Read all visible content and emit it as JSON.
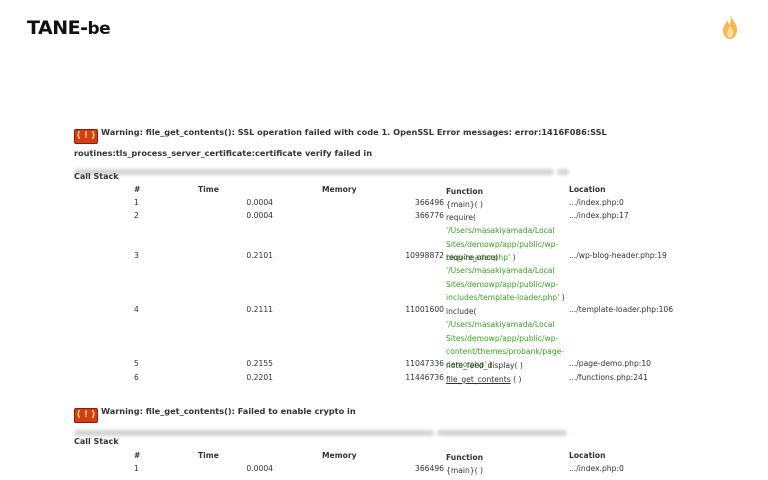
{
  "logo": {
    "main": "TANE",
    "sep": "-",
    "suffix": "be"
  },
  "warnings": [
    {
      "badge": "( ! )",
      "text": "Warning: file_get_contents(): SSL operation failed with code 1. OpenSSL Error messages: error:1416F086:SSL routines:tls_process_server_certificate:certificate verify failed in",
      "call_stack_label": "Call Stack",
      "headers": [
        "#",
        "Time",
        "Memory",
        "Function",
        "Location"
      ],
      "rows": [
        {
          "num": "1",
          "time": "0.0004",
          "memory": "366496",
          "func": "{main}( )",
          "arg": "",
          "close": "",
          "location": ".../index.php:0"
        },
        {
          "num": "2",
          "time": "0.0004",
          "memory": "366776",
          "func": "require( ",
          "arg": "'/Users/masakiyamada/Local Sites/demowp/app/public/wp-blog-header.php'",
          "close": " )",
          "location": ".../index.php:17"
        },
        {
          "num": "3",
          "time": "0.2101",
          "memory": "10998872",
          "func": "require_once( ",
          "arg": "'/Users/masakiyamada/Local Sites/demowp/app/public/wp-includes/template-loader.php'",
          "close": " )",
          "location": ".../wp-blog-header.php:19"
        },
        {
          "num": "4",
          "time": "0.2111",
          "memory": "11001600",
          "func": "include( ",
          "arg": "'/Users/masakiyamada/Local Sites/demowp/app/public/wp-content/themes/probank/page-demo.php'",
          "close": " )",
          "location": ".../template-loader.php:106"
        },
        {
          "num": "5",
          "time": "0.2155",
          "memory": "11047336",
          "func": "note_feed_display( )",
          "arg": "",
          "close": "",
          "location": ".../page-demo.php:10"
        },
        {
          "num": "6",
          "time": "0.2201",
          "memory": "11446736",
          "func": "file_get_contents",
          "arg": "",
          "close": " ( )",
          "location": ".../functions.php:241",
          "underline": true
        }
      ]
    },
    {
      "badge": "( ! )",
      "text": "Warning: file_get_contents(): Failed to enable crypto in",
      "call_stack_label": "Call Stack",
      "headers": [
        "#",
        "Time",
        "Memory",
        "Function",
        "Location"
      ],
      "rows": [
        {
          "num": "1",
          "time": "0.0004",
          "memory": "366496",
          "func": "{main}( )",
          "arg": "",
          "close": "",
          "location": ".../index.php:0"
        }
      ]
    }
  ],
  "colors": {
    "badge_bg": "#d33c1c",
    "arg_green": "#3aa421",
    "flame": "#f5a623"
  }
}
